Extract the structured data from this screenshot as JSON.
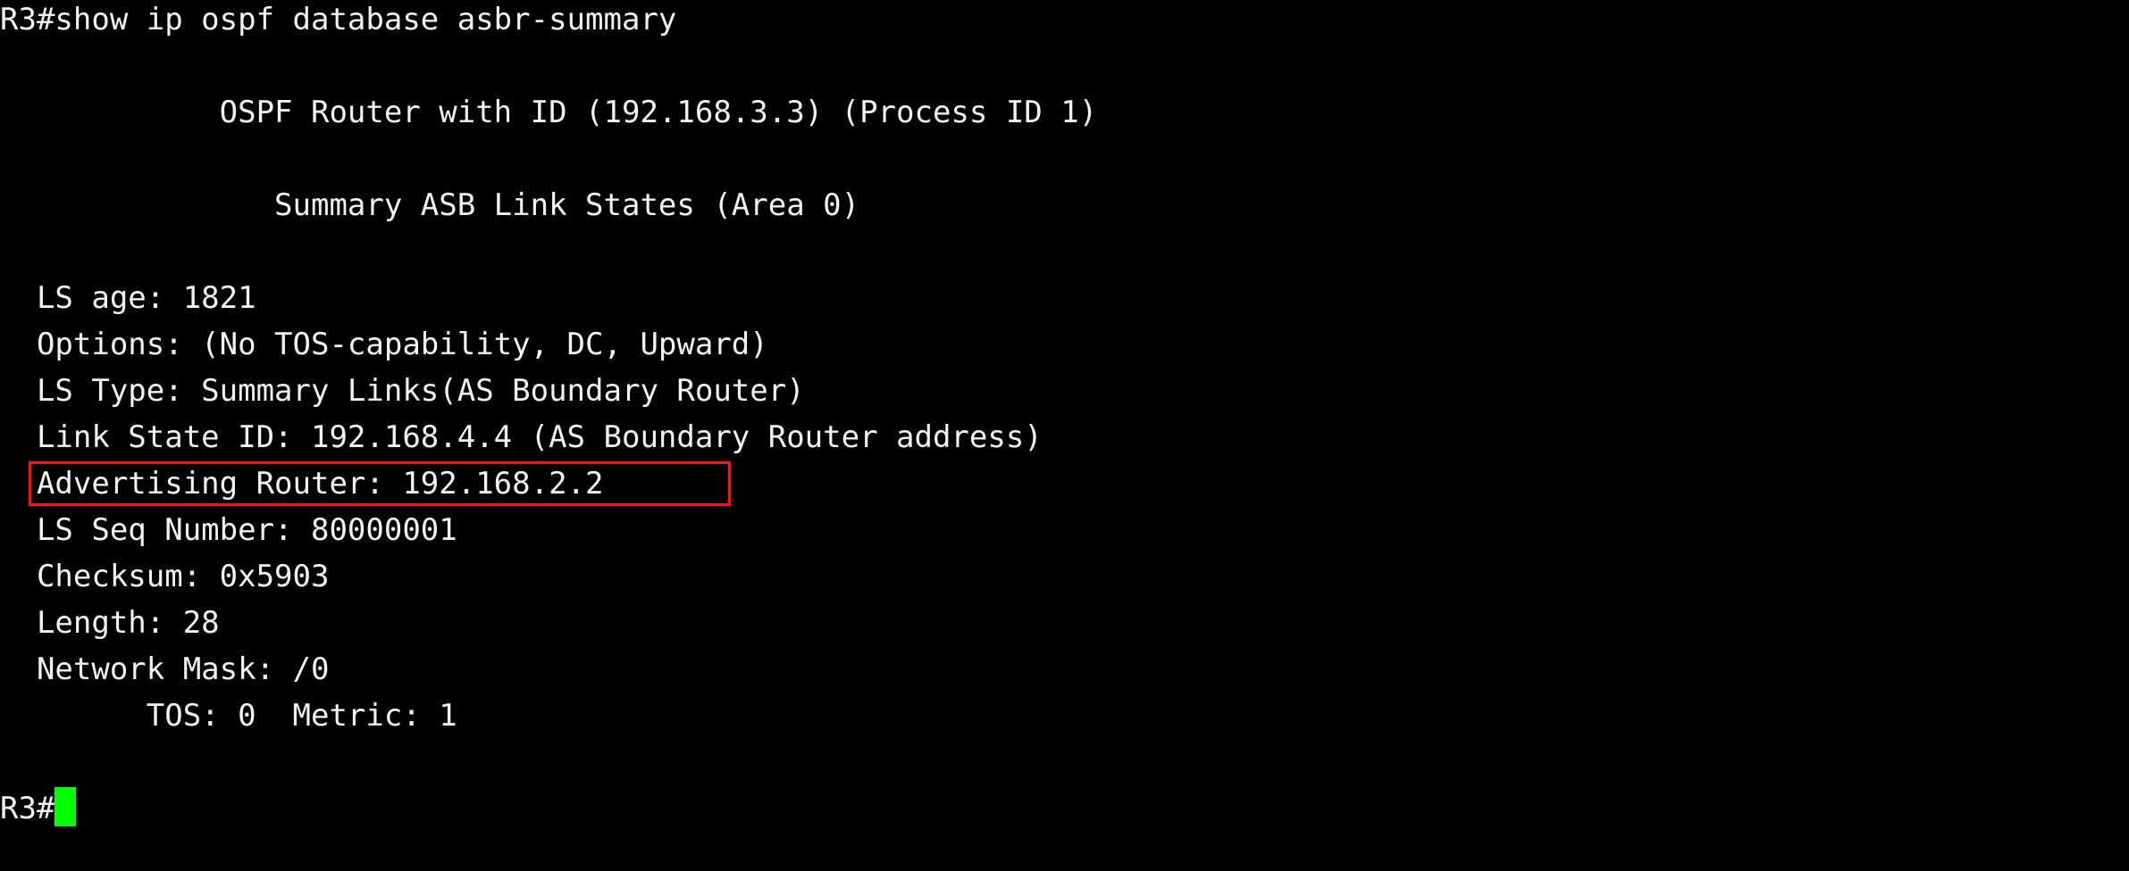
{
  "terminal": {
    "background_color": "#000000",
    "text_color": "#f2f2f2",
    "cursor_color": "#00ff00",
    "highlight_color": "#ff0f0f",
    "command_line": "R3#show ip ospf database asbr-summary",
    "header": {
      "router_line": "            OSPF Router with ID (192.168.3.3) (Process ID 1)",
      "section_line": "               Summary ASB Link States (Area 0)"
    },
    "lsa": {
      "ls_age": "  LS age: 1821",
      "options": "  Options: (No TOS-capability, DC, Upward)",
      "ls_type": "  LS Type: Summary Links(AS Boundary Router)",
      "link_state_id": "  Link State ID: 192.168.4.4 (AS Boundary Router address)",
      "advertising_router": "  Advertising Router: 192.168.2.2",
      "ls_seq_number": "  LS Seq Number: 80000001",
      "checksum": "  Checksum: 0x5903",
      "length": "  Length: 28",
      "network_mask": "  Network Mask: /0",
      "tos_metric": "        TOS: 0  Metric: 1"
    },
    "blank": " ",
    "prompt": "R3#"
  }
}
